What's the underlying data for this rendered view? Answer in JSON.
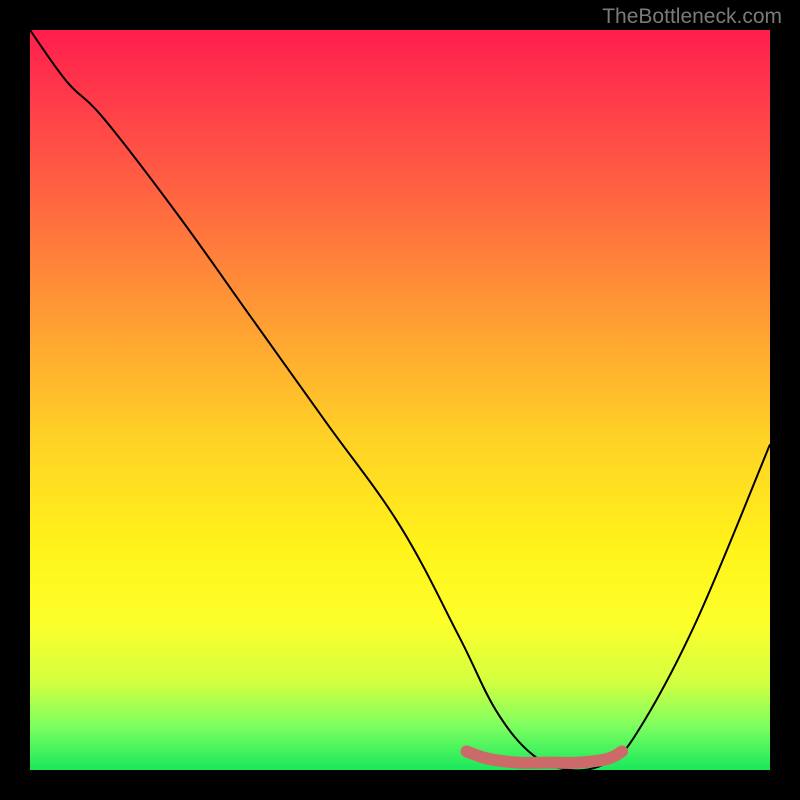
{
  "watermark": "TheBottleneck.com",
  "chart_data": {
    "type": "line",
    "title": "",
    "xlabel": "",
    "ylabel": "",
    "xlim": [
      0,
      100
    ],
    "ylim": [
      0,
      100
    ],
    "grid": false,
    "legend": false,
    "gradient_background": {
      "top": "#ff1e4c",
      "mid": "#fff31a",
      "bottom": "#19e85b"
    },
    "series": [
      {
        "name": "bottleneck-curve",
        "color": "#000000",
        "x": [
          0,
          5,
          10,
          20,
          30,
          40,
          50,
          58,
          63,
          68,
          73,
          78,
          82,
          90,
          100
        ],
        "y": [
          100,
          93,
          88,
          75,
          61,
          47,
          33,
          18,
          8,
          2,
          0,
          1,
          5,
          20,
          44
        ]
      }
    ],
    "highlight_range": {
      "name": "optimal-zone",
      "color": "#cc6a6a",
      "x": [
        59,
        62,
        66,
        70,
        74,
        78,
        80
      ],
      "y": [
        2.5,
        1.5,
        1,
        1,
        1,
        1.5,
        2.5
      ]
    }
  }
}
